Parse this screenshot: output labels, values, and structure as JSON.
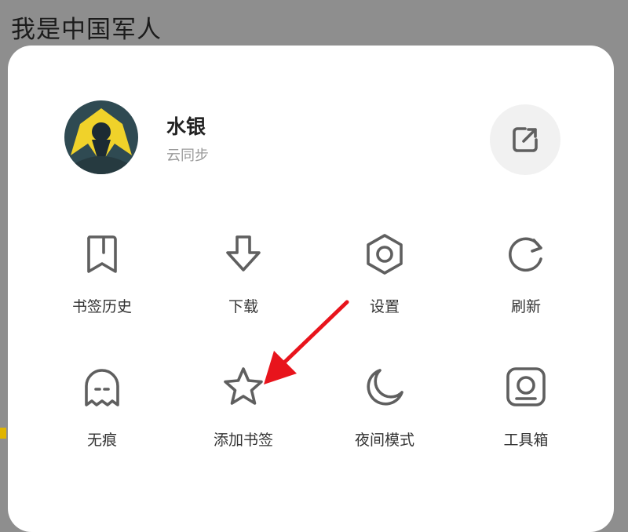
{
  "page": {
    "title": "我是中国军人"
  },
  "profile": {
    "name": "水银",
    "subtitle": "云同步"
  },
  "colors": {
    "annotation_arrow": "#e8141c",
    "icon_stroke": "#5f5f5f",
    "overlay": "#8e8e8e"
  },
  "menu": {
    "items": [
      {
        "label": "书签历史",
        "icon": "bookmark-history-icon"
      },
      {
        "label": "下载",
        "icon": "download-icon"
      },
      {
        "label": "设置",
        "icon": "settings-hexagon-icon"
      },
      {
        "label": "刷新",
        "icon": "refresh-icon"
      },
      {
        "label": "无痕",
        "icon": "ghost-icon"
      },
      {
        "label": "添加书签",
        "icon": "star-icon"
      },
      {
        "label": "夜间模式",
        "icon": "moon-icon"
      },
      {
        "label": "工具箱",
        "icon": "toolbox-icon"
      }
    ]
  }
}
